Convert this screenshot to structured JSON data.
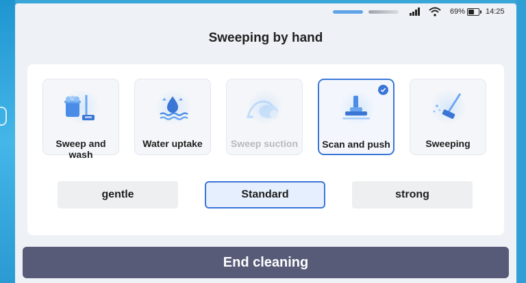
{
  "status_bar": {
    "battery_text": "69%",
    "time": "14:25",
    "icons": [
      "signal-icon",
      "wifi-icon",
      "battery-icon"
    ]
  },
  "page": {
    "title": "Sweeping by hand"
  },
  "modes": [
    {
      "label": "Sweep and wash",
      "icon": "bucket-mop-icon",
      "state": "normal"
    },
    {
      "label": "Water uptake",
      "icon": "water-drop-icon",
      "state": "normal"
    },
    {
      "label": "Sweep suction",
      "icon": "vacuum-icon",
      "state": "disabled"
    },
    {
      "label": "Scan and push",
      "icon": "push-broom-icon",
      "state": "selected"
    },
    {
      "label": "Sweeping",
      "icon": "sweeper-icon",
      "state": "normal"
    }
  ],
  "levels": [
    {
      "label": "gentle",
      "selected": false
    },
    {
      "label": "Standard",
      "selected": true
    },
    {
      "label": "strong",
      "selected": false
    }
  ],
  "actions": {
    "end_label": "End cleaning"
  },
  "colors": {
    "accent": "#3a76d6",
    "end_button": "#575b78",
    "outer_frame": "#3aa6d8"
  }
}
